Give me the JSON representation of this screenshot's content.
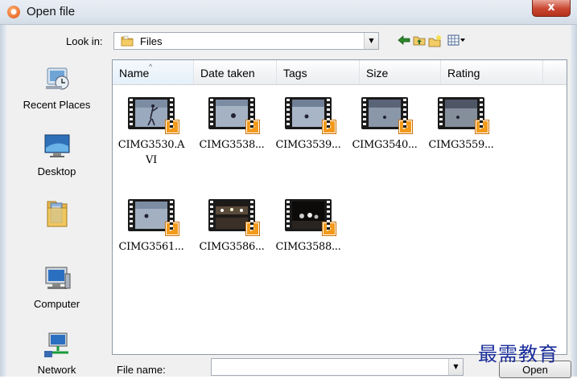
{
  "window": {
    "title": "Open file",
    "close_label": "x"
  },
  "lookin": {
    "label": "Look in:",
    "value": "Files"
  },
  "places": [
    {
      "label": "Recent Places",
      "icon": "recent-places-icon"
    },
    {
      "label": "Desktop",
      "icon": "desktop-icon"
    },
    {
      "label": "",
      "icon": "user-folder-icon"
    },
    {
      "label": "Computer",
      "icon": "computer-icon"
    },
    {
      "label": "Network",
      "icon": "network-icon"
    }
  ],
  "columns": [
    "Name",
    "Date taken",
    "Tags",
    "Size",
    "Rating"
  ],
  "files": [
    {
      "line1": "CIMG3530.A",
      "line2": "VI",
      "thumb": "ice"
    },
    {
      "line1": "CIMG3538...",
      "line2": "",
      "thumb": "ice"
    },
    {
      "line1": "CIMG3539...",
      "line2": "",
      "thumb": "ice"
    },
    {
      "line1": "CIMG3540...",
      "line2": "",
      "thumb": "ice-dark"
    },
    {
      "line1": "CIMG3559...",
      "line2": "",
      "thumb": "ice-dark"
    },
    {
      "line1": "CIMG3561...",
      "line2": "",
      "thumb": "ice"
    },
    {
      "line1": "CIMG3586...",
      "line2": "",
      "thumb": "stage"
    },
    {
      "line1": "CIMG3588...",
      "line2": "",
      "thumb": "stage-dark"
    }
  ],
  "filename": {
    "label": "File name:",
    "value": ""
  },
  "buttons": {
    "open": "Open"
  },
  "watermark": "最需教育",
  "colors": {
    "play_badge": "#f39a1a",
    "watermark": "#1a2d9a",
    "close": "#c9452f"
  }
}
